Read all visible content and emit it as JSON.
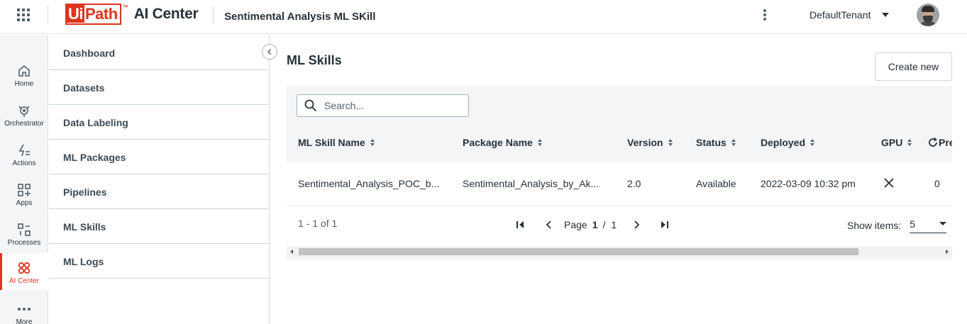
{
  "header": {
    "brand": {
      "logo_ui": "Ui",
      "logo_path": "Path",
      "logo_tm": "™",
      "product": "AI Center"
    },
    "page_title": "Sentimental Analysis ML SKill",
    "tenant": "DefaultTenant",
    "icons": {
      "apps": "apps-grid-icon",
      "more": "kebab-menu-icon",
      "tenant_caret": "caret-down-icon",
      "avatar": "user-avatar"
    }
  },
  "rail": {
    "items": [
      {
        "label": "Home",
        "icon": "home-icon"
      },
      {
        "label": "Orchestrator",
        "icon": "orchestrator-icon"
      },
      {
        "label": "Actions",
        "icon": "actions-icon"
      },
      {
        "label": "Apps",
        "icon": "apps-icon"
      },
      {
        "label": "Processes",
        "icon": "processes-icon"
      },
      {
        "label": "AI Center",
        "icon": "ai-center-icon",
        "active": true
      },
      {
        "label": "More",
        "icon": "more-dots-icon"
      }
    ],
    "accent_color": "#e0331e"
  },
  "subnav": {
    "items": [
      {
        "label": "Dashboard"
      },
      {
        "label": "Datasets"
      },
      {
        "label": "Data Labeling"
      },
      {
        "label": "ML Packages"
      },
      {
        "label": "Pipelines"
      },
      {
        "label": "ML Skills"
      },
      {
        "label": "ML Logs"
      }
    ]
  },
  "main": {
    "title": "ML Skills",
    "create_label": "Create new",
    "search": {
      "placeholder": "Search...",
      "value": ""
    },
    "columns": [
      "ML Skill Name",
      "Package Name",
      "Version",
      "Status",
      "Deployed",
      "GPU",
      "Prec"
    ],
    "rows": [
      {
        "ml_skill_name": "Sentimental_Analysis_POC_b...",
        "package_name": "Sentimental_Analysis_by_Ak...",
        "version": "2.0",
        "status": "Available",
        "deployed": "2022-03-09 10:32 pm",
        "gpu": "close-x-icon",
        "predictions": "0"
      }
    ],
    "footer": {
      "range": "1 - 1 of 1",
      "page_label": "Page",
      "page_current": "1",
      "page_sep": "/",
      "page_total": "1",
      "show_items_label": "Show items:",
      "show_items_value": "5"
    }
  }
}
